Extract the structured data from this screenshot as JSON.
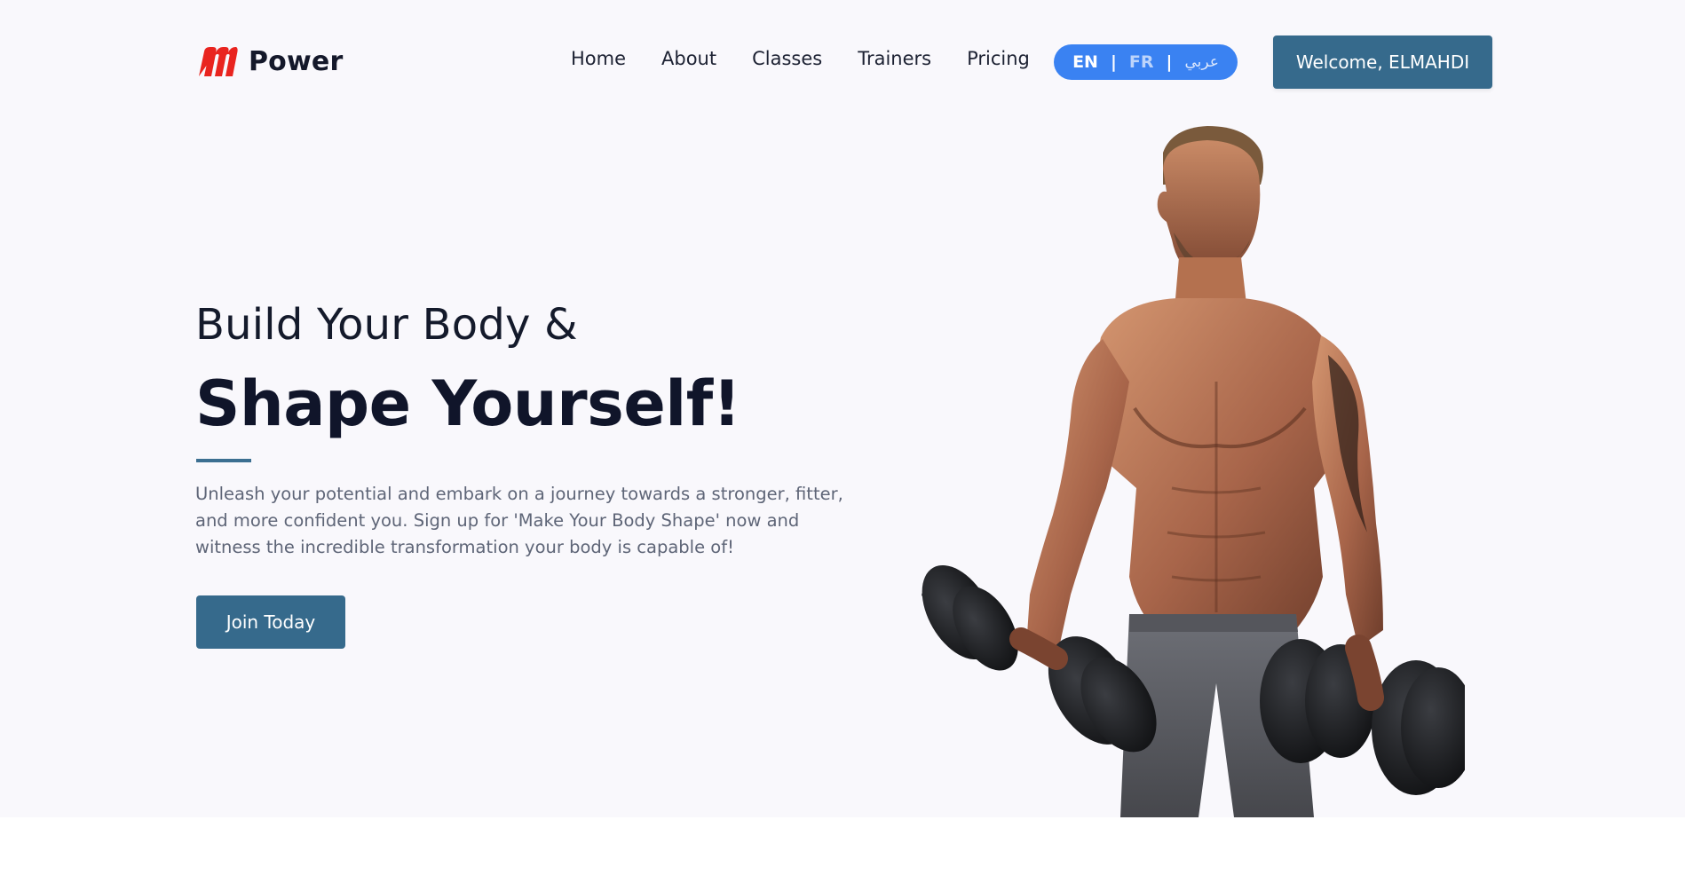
{
  "brand": {
    "name": "Power",
    "logo_color": "#e9241f"
  },
  "nav": {
    "items": [
      {
        "label": "Home"
      },
      {
        "label": "About"
      },
      {
        "label": "Classes"
      },
      {
        "label": "Trainers"
      },
      {
        "label": "Pricing"
      }
    ]
  },
  "language": {
    "options": [
      "EN",
      "FR",
      "عربي"
    ],
    "selected": "EN",
    "separator": "|",
    "bg_color": "#3a82f2"
  },
  "user": {
    "welcome_label": "Welcome, ELMAHDI"
  },
  "hero": {
    "pre_title": "Build Your Body &",
    "title": "Shape Yourself!",
    "description": "Unleash your potential and embark on a journey towards a stronger, fitter, and more confident you. Sign up for 'Make Your Body Shape' now and witness the incredible transformation your body is capable of!",
    "cta_label": "Join Today",
    "image_subject": "muscular-man-with-dumbbells-image"
  },
  "colors": {
    "primary": "#366a8c",
    "hero_bg": "#f9f8fc",
    "heading": "#10152a",
    "body_text": "#5e6577"
  }
}
